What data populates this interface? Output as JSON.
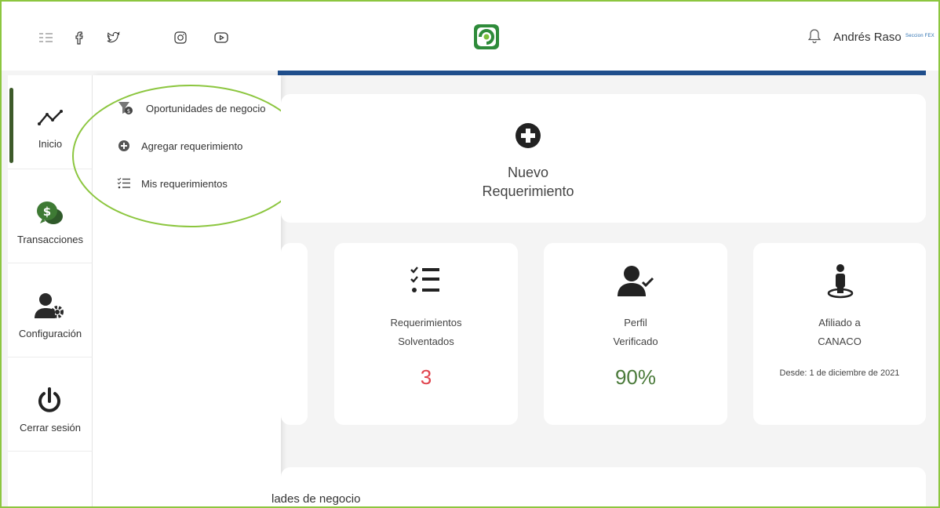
{
  "header": {
    "social_icons": [
      "facebook-icon",
      "twitter-icon",
      "instagram-icon",
      "youtube-icon"
    ],
    "user_name": "Andrés Raso",
    "brand_small": "Seccion FEX"
  },
  "sidebar": {
    "items": [
      {
        "label": "Inicio",
        "icon": "trend-chart-icon",
        "active": true
      },
      {
        "label": "Transacciones",
        "icon": "money-chat-icon"
      },
      {
        "label": "Configuración",
        "icon": "user-gear-icon"
      },
      {
        "label": "Cerrar sesión",
        "icon": "power-icon"
      }
    ]
  },
  "submenu": {
    "items": [
      {
        "label": "Oportunidades de negocio",
        "icon": "filter-dollar-icon"
      },
      {
        "label": "Agregar requerimiento",
        "icon": "plus-circle-icon"
      },
      {
        "label": "Mis requerimientos",
        "icon": "checklist-icon"
      }
    ]
  },
  "new_requirement": {
    "line1": "Nuevo",
    "line2": "Requerimiento"
  },
  "stats": [
    {
      "line1": "Requerimientos",
      "line2": "Solventados",
      "value": "3",
      "color": "#e0434d"
    },
    {
      "line1": "Perfil",
      "line2": "Verificado",
      "value": "90%",
      "color": "#4a7a3a"
    },
    {
      "line1": "Afiliado a",
      "line2": "CANACO",
      "since": "Desde: 1 de diciembre de 2021"
    }
  ],
  "bottom_card": {
    "title": "lades de negocio"
  },
  "colors": {
    "accent": "#8cc63f",
    "dark_green": "#3d5a2a",
    "blue": "#1f4e8c"
  }
}
